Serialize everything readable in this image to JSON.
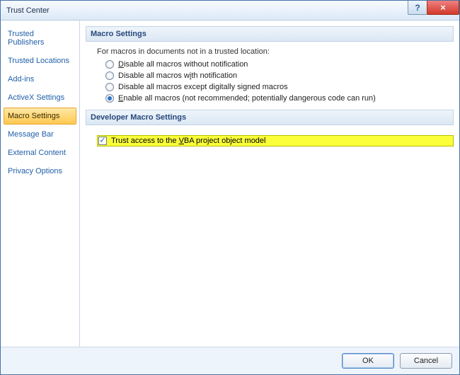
{
  "window": {
    "title": "Trust Center"
  },
  "titlebar": {
    "help_tooltip": "Help",
    "close_tooltip": "Close"
  },
  "sidebar": {
    "items": [
      {
        "label": "Trusted Publishers"
      },
      {
        "label": "Trusted Locations"
      },
      {
        "label": "Add-ins"
      },
      {
        "label": "ActiveX Settings"
      },
      {
        "label": "Macro Settings",
        "selected": true
      },
      {
        "label": "Message Bar"
      },
      {
        "label": "External Content"
      },
      {
        "label": "Privacy Options"
      }
    ]
  },
  "main": {
    "section1_title": "Macro Settings",
    "intro": "For macros in documents not in a trusted location:",
    "radios": [
      {
        "pre": "",
        "u": "D",
        "post": "isable all macros without notification",
        "checked": false
      },
      {
        "pre": "Disable all macros w",
        "u": "i",
        "post": "th notification",
        "checked": false
      },
      {
        "pre": "Disable all macros except di",
        "u": "g",
        "post": "itally signed macros",
        "checked": false
      },
      {
        "pre": "",
        "u": "E",
        "post": "nable all macros (not recommended; potentially dangerous code can run)",
        "checked": true
      }
    ],
    "section2_title": "Developer Macro Settings",
    "checkbox": {
      "pre": "Trust access to the ",
      "u": "V",
      "post": "BA project object model",
      "checked": true,
      "highlighted": true
    }
  },
  "footer": {
    "ok": "OK",
    "cancel": "Cancel"
  }
}
